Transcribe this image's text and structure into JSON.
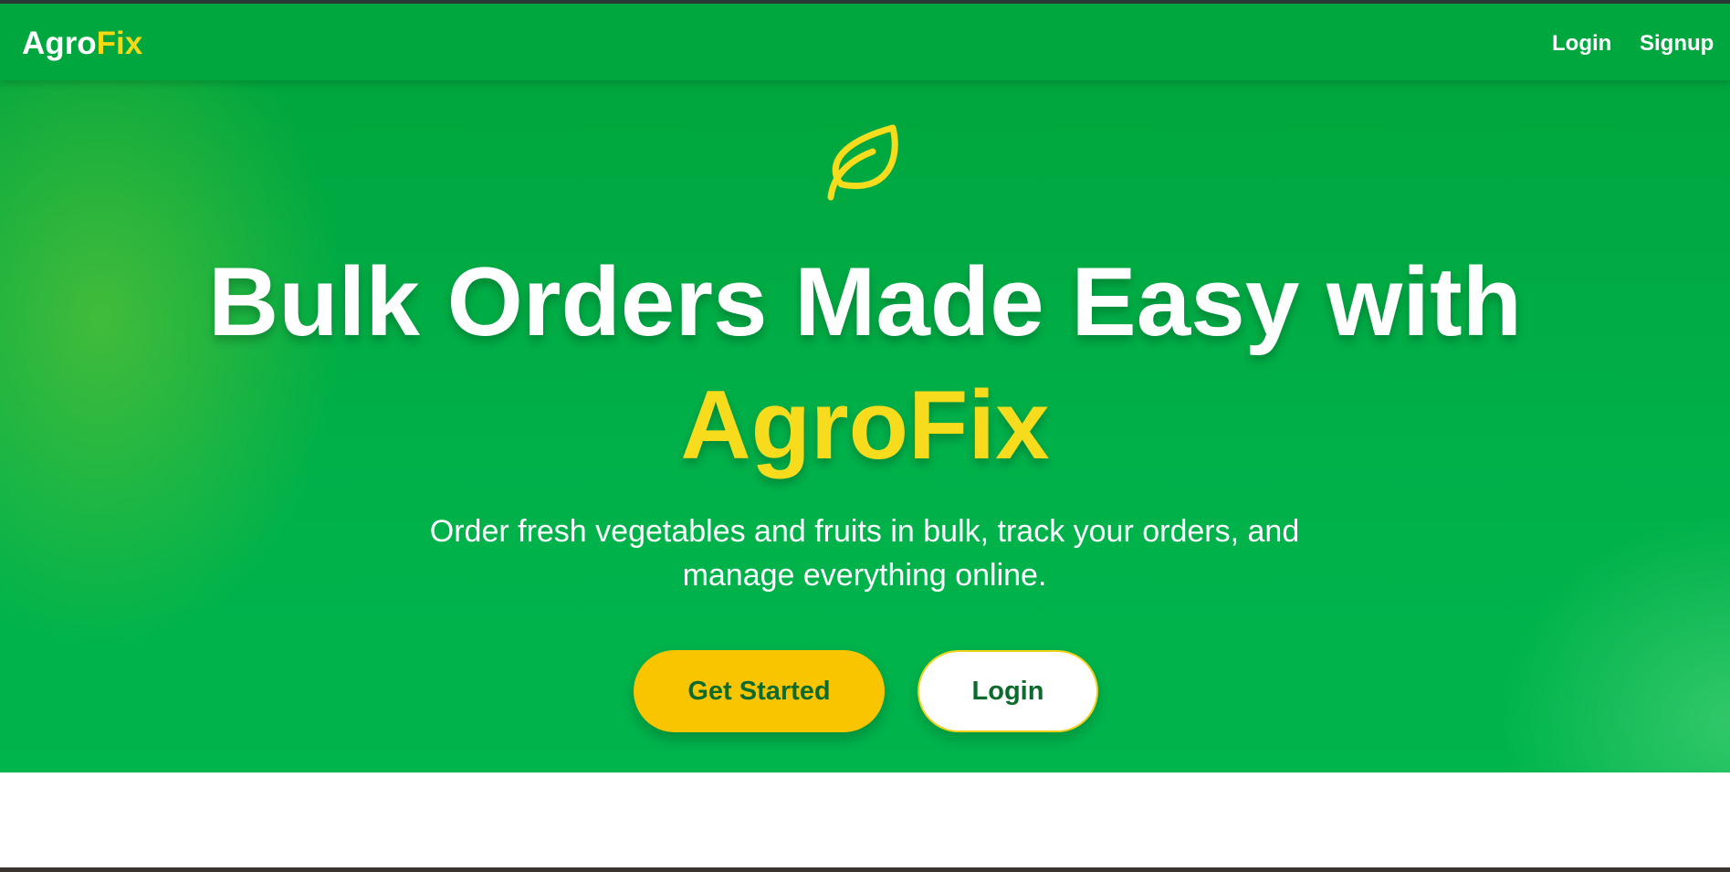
{
  "navbar": {
    "brand_part1": "Agro",
    "brand_part2": "Fix",
    "login_label": "Login",
    "signup_label": "Signup"
  },
  "hero": {
    "icon": "leaf-icon",
    "headline_line1": "Bulk Orders Made Easy with",
    "headline_line2": "AgroFix",
    "subtitle_line1": "Order fresh vegetables and fruits in bulk, track your orders, and",
    "subtitle_line2": "manage everything online.",
    "get_started_label": "Get Started",
    "login_label": "Login"
  },
  "colors": {
    "primary_green": "#00a63e",
    "accent_yellow": "#f7dc1e",
    "button_yellow": "#f8c500",
    "button_text_green": "#0b6a2c"
  }
}
